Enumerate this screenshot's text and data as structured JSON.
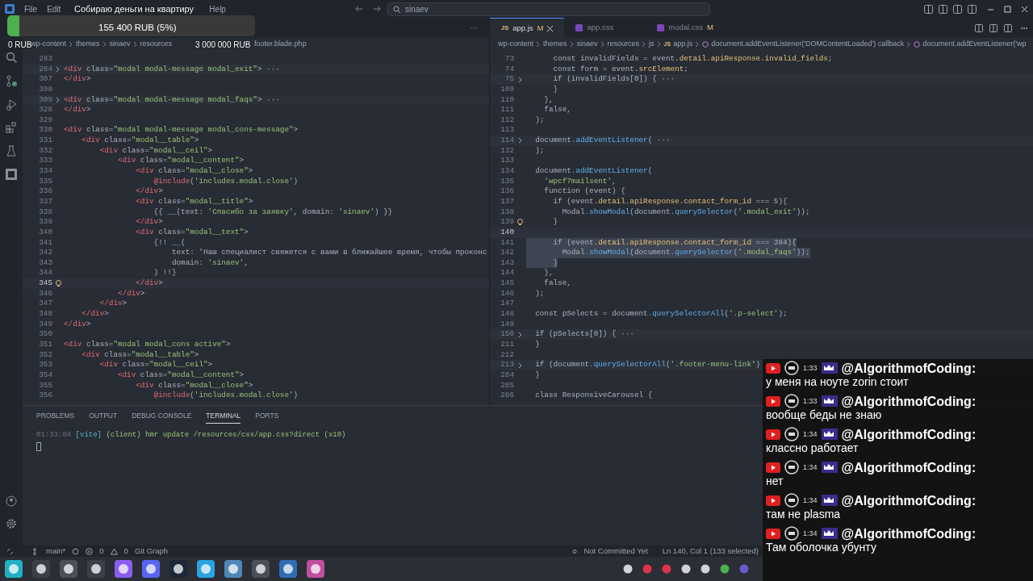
{
  "menu": [
    "File",
    "Edit",
    "Help"
  ],
  "search": {
    "value": "sinaev"
  },
  "donation": {
    "title": "Собираю деньги на квартиру",
    "amount": "155 400 RUB (5%)",
    "level": 0.05,
    "min": "0 RUB",
    "max": "3 000 000 RUB"
  },
  "left_editor": {
    "tab_overflow": "···",
    "breadcrumbs": [
      "wp-content",
      "themes",
      "sinaev",
      "resources",
      "footer.blade.php"
    ],
    "lines": [
      {
        "n": "283",
        "kind": "plain"
      },
      {
        "n": "284",
        "code": "<div class=\"modal modal-message modal_exit\"> ···",
        "kind": "folded"
      },
      {
        "n": "307",
        "code": "</div>",
        "kind": "plain"
      },
      {
        "n": "308",
        "kind": "plain"
      },
      {
        "n": "309",
        "code": "<div class=\"modal modal-message modal_faqs\"> ···",
        "kind": "folded"
      },
      {
        "n": "328",
        "code": "</div>",
        "kind": "plain"
      },
      {
        "n": "329",
        "kind": "plain"
      },
      {
        "n": "330",
        "code": "<div class=\"modal modal-message modal_cons-message\">",
        "kind": "plain"
      },
      {
        "n": "331",
        "code": "    <div class=\"modal__table\">",
        "kind": "plain"
      },
      {
        "n": "332",
        "code": "        <div class=\"modal__ceil\">",
        "kind": "plain"
      },
      {
        "n": "333",
        "code": "            <div class=\"modal__content\">",
        "kind": "plain"
      },
      {
        "n": "334",
        "code": "                <div class=\"modal__close\">",
        "kind": "plain"
      },
      {
        "n": "335",
        "code": "                    @include('includes.modal.close')",
        "kind": "plain"
      },
      {
        "n": "336",
        "code": "                </div>",
        "kind": "plain"
      },
      {
        "n": "337",
        "code": "                <div class=\"modal__title\">",
        "kind": "plain"
      },
      {
        "n": "338",
        "code": "                    {{ __(text: 'Спасибо за заявку', domain: 'sinaev') }}",
        "kind": "plain"
      },
      {
        "n": "339",
        "code": "                </div>",
        "kind": "plain"
      },
      {
        "n": "340",
        "code": "                <div class=\"modal__text\">",
        "kind": "plain"
      },
      {
        "n": "341",
        "code": "                    {!! __(",
        "kind": "plain"
      },
      {
        "n": "342",
        "code": "                        text: 'Наш специалист свяжется с вами в ближайшее время, чтобы проконс",
        "kind": "plain"
      },
      {
        "n": "343",
        "code": "                        domain: 'sinaev',",
        "kind": "plain"
      },
      {
        "n": "344",
        "code": "                    ) !!}",
        "kind": "plain"
      },
      {
        "n": "345",
        "code": "                </div>",
        "kind": "bulbcurrent"
      },
      {
        "n": "346",
        "code": "            </div>",
        "kind": "plain"
      },
      {
        "n": "347",
        "code": "        </div>",
        "kind": "plain"
      },
      {
        "n": "348",
        "code": "    </div>",
        "kind": "plain"
      },
      {
        "n": "349",
        "code": "</div>",
        "kind": "plain"
      },
      {
        "n": "350",
        "kind": "plain"
      },
      {
        "n": "351",
        "code": "<div class=\"modal modal_cons active\">",
        "kind": "plain"
      },
      {
        "n": "352",
        "code": "    <div class=\"modal__table\">",
        "kind": "plain"
      },
      {
        "n": "353",
        "code": "        <div class=\"modal__ceil\">",
        "kind": "plain"
      },
      {
        "n": "354",
        "code": "            <div class=\"modal__content\">",
        "kind": "plain"
      },
      {
        "n": "355",
        "code": "                <div class=\"modal__close\">",
        "kind": "plain"
      },
      {
        "n": "356",
        "code": "                    @include('includes.modal.close')",
        "kind": "plain"
      }
    ]
  },
  "right_editor": {
    "tabs": [
      {
        "label": "app.js",
        "kind": "js",
        "badge": "JS",
        "status": "M",
        "selected": true
      },
      {
        "label": "app.css",
        "kind": "css",
        "selected": false
      },
      {
        "label": "modal.css",
        "kind": "css",
        "status": "M",
        "selected": false
      }
    ],
    "file_badge": "JS",
    "breadcrumbs": [
      "wp-content",
      "themes",
      "sinaev",
      "resources",
      "js",
      "app.js",
      "document.addEventListener('DOMContentLoaded') callback",
      "document.addEventListener('wp"
    ],
    "lines": [
      {
        "n": "73",
        "code": "      const invalidFields = event.detail.apiResponse.invalid_fields;",
        "kind": "plain"
      },
      {
        "n": "74",
        "code": "      const form = event.srcElement;",
        "kind": "plain"
      },
      {
        "n": "75",
        "code": "      if (invalidFields[0]) { ···",
        "kind": "folded"
      },
      {
        "n": "109",
        "code": "      }",
        "kind": "plain"
      },
      {
        "n": "110",
        "code": "    },",
        "kind": "plain"
      },
      {
        "n": "111",
        "code": "    false,",
        "kind": "plain"
      },
      {
        "n": "112",
        "code": "  );",
        "kind": "plain"
      },
      {
        "n": "113",
        "kind": "plain"
      },
      {
        "n": "114",
        "code": "  document.addEventListener( ···",
        "kind": "folded"
      },
      {
        "n": "132",
        "code": "  );",
        "kind": "plain"
      },
      {
        "n": "133",
        "kind": "plain"
      },
      {
        "n": "134",
        "code": "  document.addEventListener(",
        "kind": "plain"
      },
      {
        "n": "135",
        "code": "    'wpcf7mailsent',",
        "kind": "plain"
      },
      {
        "n": "136",
        "code": "    function (event) {",
        "kind": "plain"
      },
      {
        "n": "137",
        "code": "      if (event.detail.apiResponse.contact_form_id === 5){",
        "kind": "plain"
      },
      {
        "n": "138",
        "code": "        Modal.showModal(document.querySelector('.modal_exit'));",
        "kind": "plain"
      },
      {
        "n": "139",
        "code": "      }",
        "kind": "bulb"
      },
      {
        "n": "140",
        "kind": "current"
      },
      {
        "n": "141",
        "code": "      if (event.detail.apiResponse.contact_form_id === 394){",
        "kind": "selected"
      },
      {
        "n": "142",
        "code": "        Modal.showModal(document.querySelector('.modal_faqs'));",
        "kind": "selected"
      },
      {
        "n": "143",
        "code": "      }",
        "kind": "selected"
      },
      {
        "n": "144",
        "code": "    },",
        "kind": "plain"
      },
      {
        "n": "145",
        "code": "    false,",
        "kind": "plain"
      },
      {
        "n": "146",
        "code": "  );",
        "kind": "plain"
      },
      {
        "n": "147",
        "kind": "plain"
      },
      {
        "n": "148",
        "code": "  const pSelects = document.querySelectorAll('.p-select');",
        "kind": "plain"
      },
      {
        "n": "149",
        "kind": "plain"
      },
      {
        "n": "150",
        "code": "  if (pSelects[0]) { ···",
        "kind": "folded"
      },
      {
        "n": "211",
        "code": "  }",
        "kind": "plain"
      },
      {
        "n": "212",
        "kind": "plain"
      },
      {
        "n": "213",
        "code": "  if (document.querySelectorAll('.footer-menu-link')",
        "kind": "folded"
      },
      {
        "n": "284",
        "code": "  }",
        "kind": "plain"
      },
      {
        "n": "285",
        "kind": "plain"
      },
      {
        "n": "286",
        "code": "  class ResponsiveCarousel {",
        "kind": "plain"
      }
    ]
  },
  "panel": {
    "tabs": [
      {
        "label": "PROBLEMS",
        "selected": false
      },
      {
        "label": "OUTPUT",
        "selected": false
      },
      {
        "label": "DEBUG CONSOLE",
        "selected": false
      },
      {
        "label": "TERMINAL",
        "selected": true
      },
      {
        "label": "PORTS",
        "selected": false
      }
    ],
    "terminal": [
      {
        "time": "01:33:04",
        "tag": "[vite]",
        "rest": "(client) hmr update /resources/css/app.css?direct (x10)"
      }
    ]
  },
  "status_bar": {
    "branch": "main*",
    "errors": "0",
    "warnings": "0",
    "git_graph": "Git Graph",
    "blame": "Not Committed Yet",
    "position": "Ln 140, Col 1 (133 selected)"
  },
  "chat": [
    {
      "time": "1:33",
      "user": "@AlgorithmofCoding:",
      "text": "у меня на ноуте zorin стоит"
    },
    {
      "time": "1:33",
      "user": "@AlgorithmofCoding:",
      "text": "вообще беды не знаю"
    },
    {
      "time": "1:34",
      "user": "@AlgorithmofCoding:",
      "text": "классно работает"
    },
    {
      "time": "1:34",
      "user": "@AlgorithmofCoding:",
      "text": "нет"
    },
    {
      "time": "1:34",
      "user": "@AlgorithmofCoding:",
      "text": "там не plasma"
    },
    {
      "time": "1:34",
      "user": "@AlgorithmofCoding:",
      "text": "Там оболочка убунту"
    }
  ]
}
